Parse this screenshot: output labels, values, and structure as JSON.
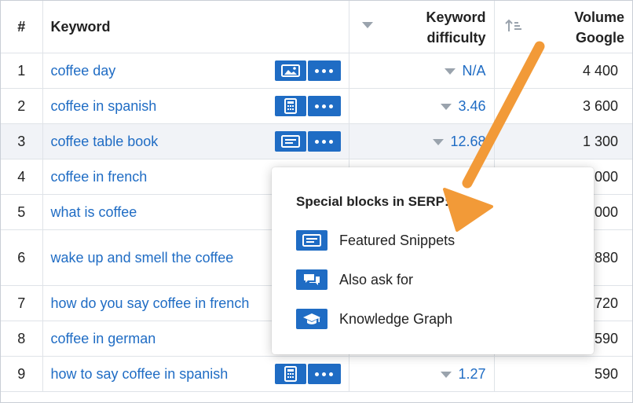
{
  "table": {
    "headers": {
      "num": "#",
      "keyword": "Keyword",
      "kd_line1": "Keyword",
      "kd_line2": "difficulty",
      "vol_line1": "Volume",
      "vol_line2": "Google"
    },
    "rows": [
      {
        "num": "1",
        "keyword": "coffee day",
        "kd": "N/A",
        "volume": "4 400",
        "icon": "image-icon",
        "show_buttons": true
      },
      {
        "num": "2",
        "keyword": "coffee in spanish",
        "kd": "3.46",
        "volume": "3 600",
        "icon": "calculator-icon",
        "show_buttons": true
      },
      {
        "num": "3",
        "keyword": "coffee table book",
        "kd": "12.68",
        "volume": "1 300",
        "icon": "featured-snippet-icon",
        "show_buttons": true,
        "highlighted": true
      },
      {
        "num": "4",
        "keyword": "coffee in french",
        "kd": "",
        "volume": "000"
      },
      {
        "num": "5",
        "keyword": "what is coffee",
        "kd": "",
        "volume": "000"
      },
      {
        "num": "6",
        "keyword": "wake up and smell the coffee",
        "kd": "",
        "volume": "880"
      },
      {
        "num": "7",
        "keyword": "how do you say coffee in french",
        "kd": "",
        "volume": "720"
      },
      {
        "num": "8",
        "keyword": "coffee in german",
        "kd": "",
        "volume": "590"
      },
      {
        "num": "9",
        "keyword": "how to say coffee in spanish",
        "kd": "1.27",
        "volume": "590",
        "icon": "calculator-icon",
        "show_buttons": true
      }
    ]
  },
  "popup": {
    "title": "Special blocks in SERP:",
    "items": [
      {
        "label": "Featured Snippets",
        "icon": "featured-snippet-icon"
      },
      {
        "label": "Also ask for",
        "icon": "chat-bubbles-icon"
      },
      {
        "label": "Knowledge Graph",
        "icon": "graduation-cap-icon"
      }
    ]
  },
  "colors": {
    "link": "#1f6cc4",
    "button": "#1f6cc4",
    "arrow": "#f29a38",
    "row_highlight": "#f1f3f7",
    "grid": "#dfe3e8"
  }
}
